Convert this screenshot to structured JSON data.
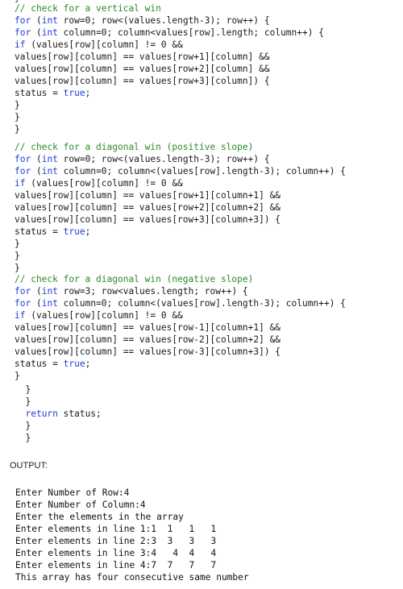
{
  "code_block_1": [
    {
      "parts": [
        {
          "t": "// check for a vertical win",
          "c": "cm"
        }
      ]
    },
    {
      "parts": [
        {
          "t": "for",
          "c": "kw"
        },
        {
          "t": " ("
        },
        {
          "t": "int",
          "c": "kw"
        },
        {
          "t": " row=0; row<(values.length-3); row++) {"
        }
      ]
    },
    {
      "parts": [
        {
          "t": "for",
          "c": "kw"
        },
        {
          "t": " ("
        },
        {
          "t": "int",
          "c": "kw"
        },
        {
          "t": " column=0; column<values[row].length; column++) {"
        }
      ]
    },
    {
      "parts": [
        {
          "t": "if",
          "c": "kw"
        },
        {
          "t": " (values[row][column] != 0 &&"
        }
      ]
    },
    {
      "parts": [
        {
          "t": "values[row][column] == values[row+1][column] &&"
        }
      ]
    },
    {
      "parts": [
        {
          "t": "values[row][column] == values[row+2][column] &&"
        }
      ]
    },
    {
      "parts": [
        {
          "t": "values[row][column] == values[row+3][column]) {"
        }
      ]
    },
    {
      "parts": [
        {
          "t": "status = "
        },
        {
          "t": "true",
          "c": "kw"
        },
        {
          "t": ";"
        }
      ]
    },
    {
      "parts": [
        {
          "t": "}"
        }
      ]
    },
    {
      "parts": [
        {
          "t": "}"
        }
      ]
    },
    {
      "parts": [
        {
          "t": "}"
        }
      ]
    }
  ],
  "code_block_2": [
    {
      "parts": [
        {
          "t": "// check for a diagonal win (positive slope)",
          "c": "cm"
        }
      ]
    },
    {
      "parts": [
        {
          "t": "for",
          "c": "kw"
        },
        {
          "t": " ("
        },
        {
          "t": "int",
          "c": "kw"
        },
        {
          "t": " row=0; row<(values.length-3); row++) {"
        }
      ]
    },
    {
      "parts": [
        {
          "t": "for",
          "c": "kw"
        },
        {
          "t": " ("
        },
        {
          "t": "int",
          "c": "kw"
        },
        {
          "t": " column=0; column<(values[row].length-3); column++) {"
        }
      ]
    },
    {
      "parts": [
        {
          "t": "if",
          "c": "kw"
        },
        {
          "t": " (values[row][column] != 0 &&"
        }
      ]
    },
    {
      "parts": [
        {
          "t": "values[row][column] == values[row+1][column+1] &&"
        }
      ]
    },
    {
      "parts": [
        {
          "t": "values[row][column] == values[row+2][column+2] &&"
        }
      ]
    },
    {
      "parts": [
        {
          "t": "values[row][column] == values[row+3][column+3]) {"
        }
      ]
    },
    {
      "parts": [
        {
          "t": "status = "
        },
        {
          "t": "true",
          "c": "kw"
        },
        {
          "t": ";"
        }
      ]
    },
    {
      "parts": [
        {
          "t": "}"
        }
      ]
    },
    {
      "parts": [
        {
          "t": "}"
        }
      ]
    },
    {
      "parts": [
        {
          "t": "}"
        }
      ]
    }
  ],
  "code_block_3": [
    {
      "parts": [
        {
          "t": "// check for a diagonal win (negative slope)",
          "c": "cm"
        }
      ]
    },
    {
      "parts": [
        {
          "t": "for",
          "c": "kw"
        },
        {
          "t": " ("
        },
        {
          "t": "int",
          "c": "kw"
        },
        {
          "t": " row=3; row<values.length; row++) {"
        }
      ]
    },
    {
      "parts": [
        {
          "t": "for",
          "c": "kw"
        },
        {
          "t": " ("
        },
        {
          "t": "int",
          "c": "kw"
        },
        {
          "t": " column=0; column<(values[row].length-3); column++) {"
        }
      ]
    },
    {
      "parts": [
        {
          "t": "if",
          "c": "kw"
        },
        {
          "t": " (values[row][column] != 0 &&"
        }
      ]
    },
    {
      "parts": [
        {
          "t": "values[row][column] == values[row-1][column+1] &&"
        }
      ]
    },
    {
      "parts": [
        {
          "t": "values[row][column] == values[row-2][column+2] &&"
        }
      ]
    },
    {
      "parts": [
        {
          "t": "values[row][column] == values[row-3][column+3]) {"
        }
      ]
    },
    {
      "parts": [
        {
          "t": "status = "
        },
        {
          "t": "true",
          "c": "kw"
        },
        {
          "t": ";"
        }
      ]
    },
    {
      "parts": [
        {
          "t": "}"
        }
      ]
    }
  ],
  "code_block_4": [
    {
      "parts": [
        {
          "t": "  }"
        }
      ]
    },
    {
      "parts": [
        {
          "t": "  }"
        }
      ]
    },
    {
      "parts": [
        {
          "t": "  "
        },
        {
          "t": "return",
          "c": "kw"
        },
        {
          "t": " status;"
        }
      ]
    },
    {
      "parts": [
        {
          "t": "  }"
        }
      ]
    },
    {
      "parts": [
        {
          "t": "  }"
        }
      ]
    }
  ],
  "output_label": "OUTPUT:",
  "output_lines": [
    "Enter Number of Row:4",
    "Enter Number of Column:4",
    "Enter the elements in the array",
    "Enter elements in line 1:1  1   1   1",
    "Enter elements in line 2:3  3   3   3",
    "Enter elements in line 3:4   4  4   4",
    "Enter elements in line 4:7  7   7   7",
    "This array has four consecutive same number"
  ],
  "colors": {
    "comment": "#2a8a2a",
    "keyword": "#1f3fd6",
    "text": "#1a1a1a"
  }
}
